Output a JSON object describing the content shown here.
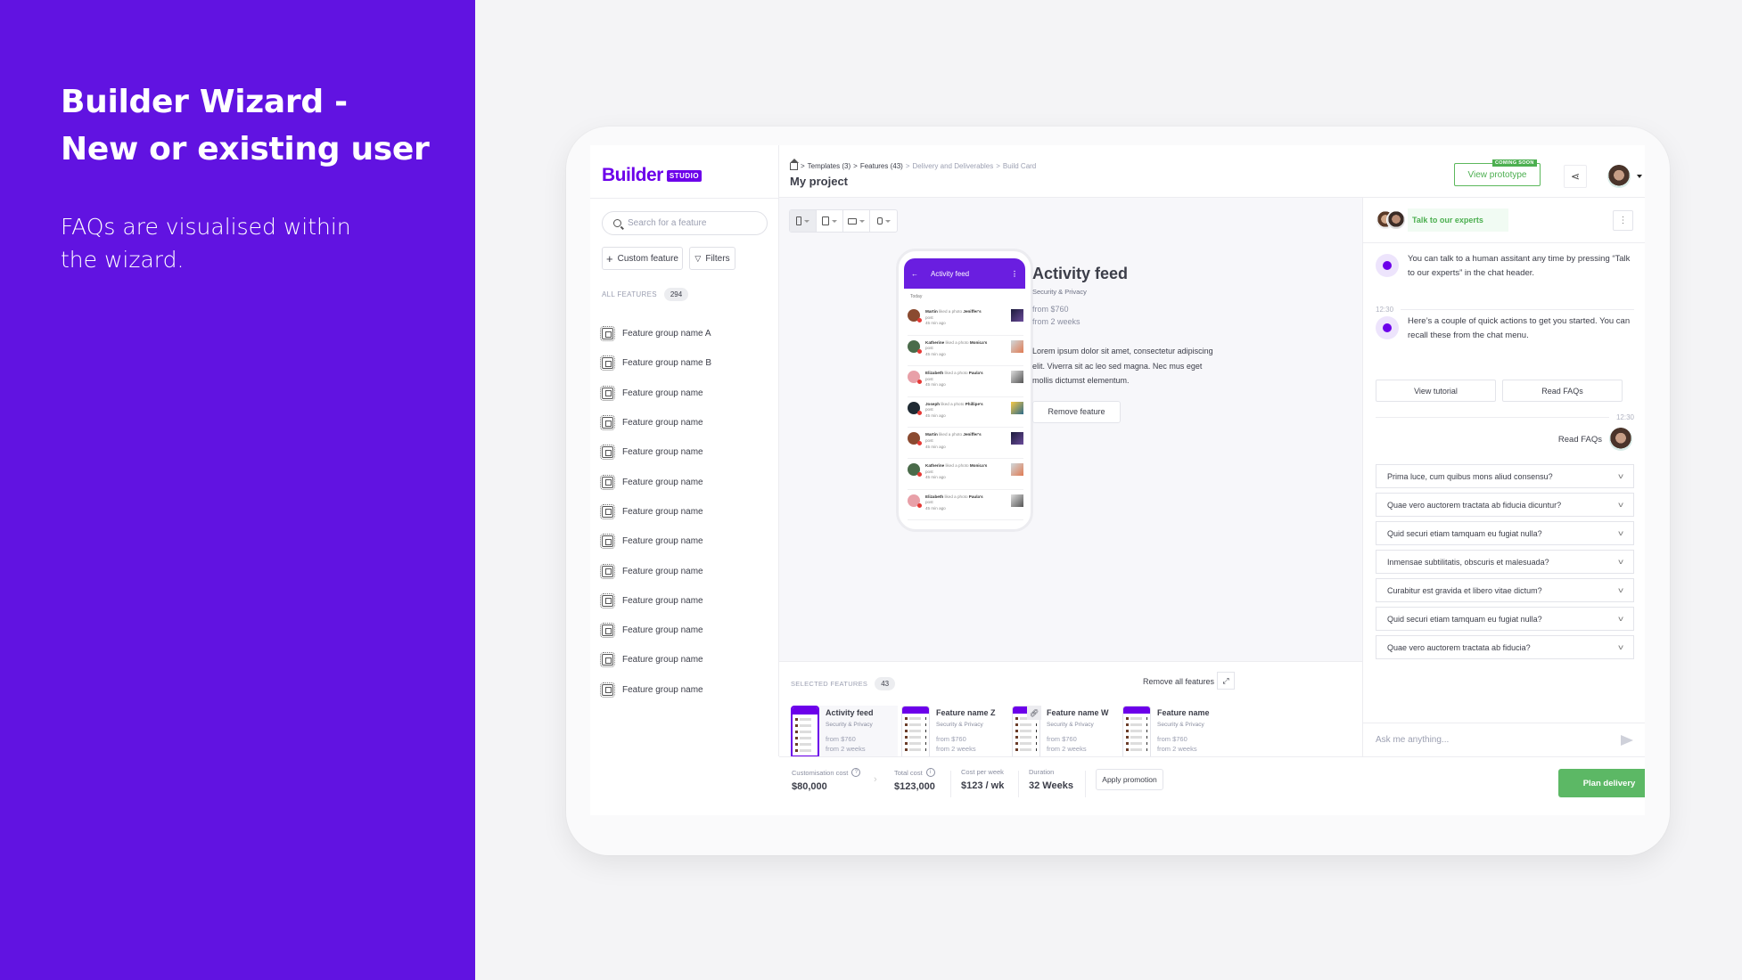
{
  "slide": {
    "title_line1": "Builder Wizard -",
    "title_line2": "New or existing user",
    "description_line1": "FAQs are visualised within",
    "description_line2": "the wizard.",
    "accent_color": "#6113e1"
  },
  "app": {
    "logo_word": "Builder",
    "logo_badge": "STUDIO",
    "brand_color": "#6c00ea",
    "breadcrumb": {
      "items": [
        "Templates (3)",
        "Features (43)",
        "Delivery and Deliverables",
        "Build Card"
      ],
      "separator": ">"
    },
    "project_title": "My project",
    "header": {
      "view_prototype": "View prototype",
      "coming_soon": "COMING SOON",
      "share_icon": "share-icon"
    }
  },
  "sidebar": {
    "search_placeholder": "Search for a feature",
    "custom_feature_label": "Custom feature",
    "filters_label": "Filters",
    "all_features_label": "ALL FEATURES",
    "all_features_count": "294",
    "items": [
      "Feature group name A",
      "Feature group name B",
      "Feature group name",
      "Feature group name",
      "Feature group name",
      "Feature group name",
      "Feature group name",
      "Feature group name",
      "Feature group name",
      "Feature group name",
      "Feature group name",
      "Feature group name",
      "Feature group name"
    ]
  },
  "main": {
    "device_tabs": [
      "mobile",
      "tablet",
      "desktop",
      "watch"
    ],
    "active_device": "mobile",
    "phone": {
      "title": "Activity feed",
      "section": "Today",
      "activities": [
        {
          "user": "Martin",
          "action": "liked a photo",
          "target": "Jeniffer's",
          "suffix": "post",
          "time": "45 min ago"
        },
        {
          "user": "Katherine",
          "action": "liked a photo",
          "target": "Monica's",
          "suffix": "post",
          "time": "45 min ago"
        },
        {
          "user": "Elizabeth",
          "action": "liked a photo",
          "target": "Paula's",
          "suffix": "post",
          "time": "45 min ago"
        },
        {
          "user": "Joseph",
          "action": "liked a photo",
          "target": "Phillipe's",
          "suffix": "post",
          "time": "45 min ago"
        },
        {
          "user": "Martin",
          "action": "liked a photo",
          "target": "Jeniffer's",
          "suffix": "post",
          "time": "45 min ago"
        },
        {
          "user": "Katherine",
          "action": "liked a photo",
          "target": "Monica's",
          "suffix": "post",
          "time": "45 min ago"
        },
        {
          "user": "Elizabeth",
          "action": "liked a photo",
          "target": "Paula's",
          "suffix": "post",
          "time": "45 min ago"
        }
      ]
    },
    "feature": {
      "title": "Activity feed",
      "category": "Security & Privacy",
      "price": "from $760",
      "duration": "from 2 weeks",
      "description": "Lorem ipsum dolor sit amet, consectetur adipiscing elit. Viverra sit ac leo sed magna. Nec mus eget mollis dictumst elementum.",
      "remove_label": "Remove feature"
    }
  },
  "selected": {
    "label": "SELECTED FEATURES",
    "count": "43",
    "remove_all_label": "Remove all features",
    "cards": [
      {
        "name": "Activity feed",
        "category": "Security & Privacy",
        "price": "from $760",
        "duration": "from 2 weeks",
        "active": true
      },
      {
        "name": "Feature name Z",
        "category": "Security & Privacy",
        "price": "from $760",
        "duration": "from 2 weeks",
        "active": false
      },
      {
        "name": "Feature name W",
        "category": "Security & Privacy",
        "price": "from $760",
        "duration": "from 2 weeks",
        "active": false,
        "linked": true
      },
      {
        "name": "Feature name",
        "category": "Security & Privacy",
        "price": "from $760",
        "duration": "from 2 weeks",
        "active": false
      }
    ]
  },
  "footer": {
    "customisation_cost_label": "Customisation cost",
    "customisation_cost": "$80,000",
    "total_cost_label": "Total cost",
    "total_cost": "$123,000",
    "cost_per_week_label": "Cost per week",
    "cost_per_week": "$123 / wk",
    "duration_label": "Duration",
    "duration": "32 Weeks",
    "apply_promotion": "Apply promotion",
    "plan_delivery": "Plan delivery",
    "plan_color": "#5cb865"
  },
  "chat": {
    "talk_to_experts": "Talk to our experts",
    "messages": [
      "You can talk to a human assitant any time by pressing “Talk to our experts” in the chat header.",
      "Here’s a couple of quick actions to get you started. You can recall these from the chat menu."
    ],
    "time1": "12:30",
    "time2": "12:30",
    "quick_actions": [
      "View tutorial",
      "Read FAQs"
    ],
    "user_message": "Read FAQs",
    "faqs": [
      "Prima luce, cum quibus mons aliud consensu?",
      "Quae vero auctorem tractata ab fiducia dicuntur?",
      "Quid securi etiam tamquam eu fugiat nulla?",
      "Inmensae subtilitatis, obscuris et malesuada?",
      "Curabitur est gravida et libero vitae dictum?",
      "Quid securi etiam tamquam eu fugiat nulla?",
      "Quae vero auctorem tractata ab fiducia?"
    ],
    "input_placeholder": "Ask me anything..."
  }
}
